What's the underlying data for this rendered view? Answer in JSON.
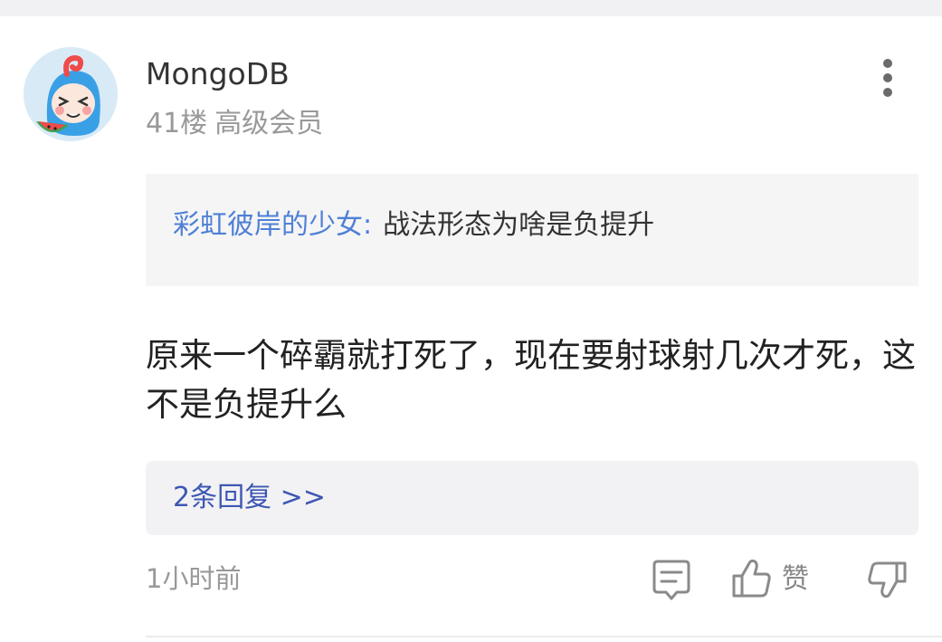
{
  "post": {
    "username": "MongoDB",
    "floor": "41楼",
    "member_level": "高级会员",
    "quote": {
      "author": "彩虹彼岸的少女",
      "separator": ":",
      "text": "战法形态为啥是负提升"
    },
    "content": "原来一个碎霸就打死了，现在要射球射几次才死，这不是负提升么",
    "replies_link": "2条回复 >>",
    "time": "1小时前",
    "actions": {
      "comment_icon": "comment-icon",
      "like_icon": "thumbs-up-icon",
      "like_label": "赞",
      "dislike_icon": "thumbs-down-icon"
    },
    "more_icon": "more-vertical-icon"
  },
  "colors": {
    "quote_author": "#4f80d6",
    "replies_link": "#3d57b3",
    "muted_text": "#999999",
    "quote_background": "#f5f5f5"
  }
}
